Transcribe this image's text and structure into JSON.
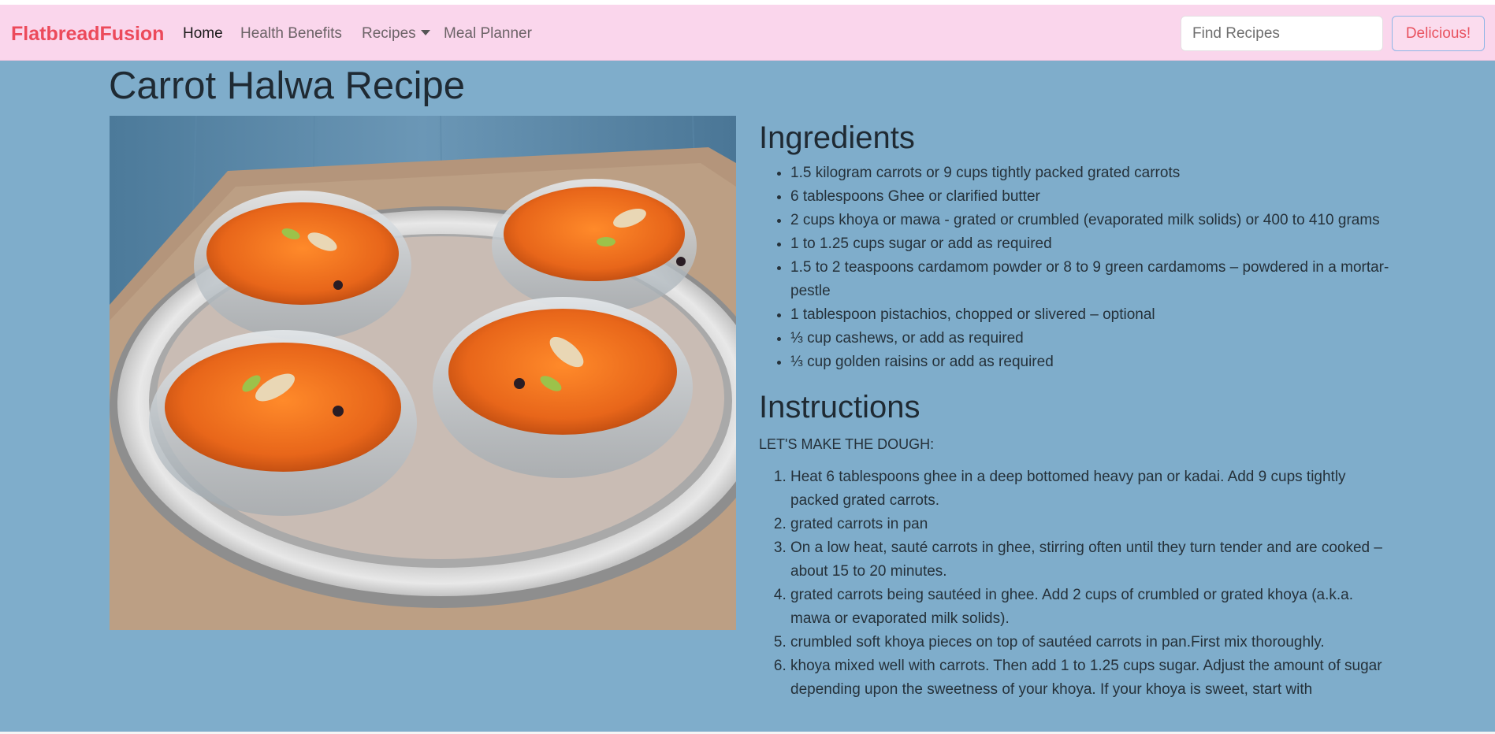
{
  "navbar": {
    "brand": "FlatbreadFusion",
    "links": [
      {
        "label": "Home"
      },
      {
        "label": "Health Benefits"
      },
      {
        "label": "Recipes"
      },
      {
        "label": "Meal Planner"
      }
    ],
    "search_placeholder": "Find Recipes",
    "button_label": "Delicious!"
  },
  "recipe": {
    "title": "Carrot Halwa Recipe",
    "ingredients_title": "Ingredients",
    "ingredients": [
      "1.5 kilogram carrots or 9 cups tightly packed grated carrots",
      "6 tablespoons Ghee or clarified butter",
      "2 cups khoya or mawa - grated or crumbled (evaporated milk solids) or 400 to 410 grams",
      "1 to 1.25 cups sugar or add as required",
      "1.5 to 2 teaspoons cardamom powder or 8 to 9 green cardamoms – powdered in a mortar-pestle",
      "1 tablespoon pistachios, chopped or slivered – optional",
      "⅓ cup cashews, or add as required",
      "⅓ cup golden raisins or add as required"
    ],
    "instructions_title": "Instructions",
    "instructions_subhead": "LET'S MAKE THE DOUGH:",
    "instructions": [
      "Heat 6 tablespoons ghee in a deep bottomed heavy pan or kadai. Add 9 cups tightly packed grated carrots.",
      "grated carrots in pan",
      "On a low heat, sauté carrots in ghee, stirring often until they turn tender and are cooked – about 15 to 20 minutes.",
      "grated carrots being sautéed in ghee. Add 2 cups of crumbled or grated khoya (a.k.a. mawa or evaporated milk solids).",
      "crumbled soft khoya pieces on top of sautéed carrots in pan.First mix thoroughly.",
      "khoya mixed well with carrots. Then add 1 to 1.25 cups sugar. Adjust the amount of sugar depending upon the sweetness of your khoya. If your khoya is sweet, start with"
    ]
  },
  "colors": {
    "navbar_bg": "#fad6ec",
    "brand": "#ec4a5b",
    "main_bg": "#7fadcb",
    "button_border": "#8fb6e6"
  }
}
